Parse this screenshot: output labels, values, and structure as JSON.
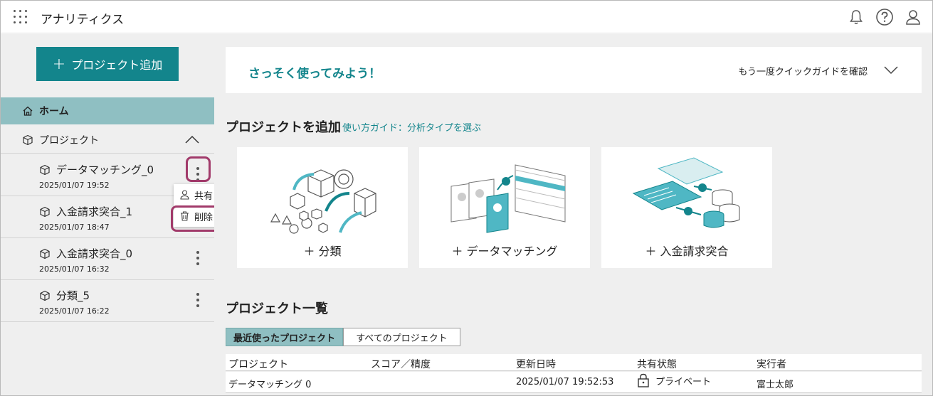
{
  "header": {
    "app_title": "アナリティクス",
    "icons": [
      "apps-grid-icon",
      "bell-icon",
      "help-icon",
      "user-icon"
    ]
  },
  "sidebar": {
    "add_button_label": "プロジェクト追加",
    "home_label": "ホーム",
    "project_label": "プロジェクト",
    "projects": [
      {
        "name": "データマッチング_0",
        "date": "2025/01/07 19:52"
      },
      {
        "name": "入金請求突合_1",
        "date": "2025/01/07 18:47"
      },
      {
        "name": "入金請求突合_0",
        "date": "2025/01/07 16:32"
      },
      {
        "name": "分類_5",
        "date": "2025/01/07 16:22"
      }
    ],
    "context_menu": {
      "share_label": "共有",
      "delete_label": "削除"
    }
  },
  "main": {
    "banner_title": "さっそく使ってみよう！",
    "banner_link": "もう一度クイックガイドを確認",
    "add_section_title": "プロジェクトを追加",
    "guide_link": "使い方ガイド：分析タイプを選ぶ",
    "cards": [
      {
        "label": "分類"
      },
      {
        "label": "データマッチング"
      },
      {
        "label": "入金請求突合"
      }
    ],
    "list_title": "プロジェクト一覧",
    "tabs": [
      {
        "label": "最近使ったプロジェクト",
        "active": true
      },
      {
        "label": "すべてのプロジェクト",
        "active": false
      }
    ],
    "columns": [
      "プロジェクト",
      "スコア／精度",
      "更新日時",
      "共有状態",
      "実行者"
    ],
    "rows": [
      {
        "project": "データマッチング 0",
        "score": "",
        "updated": "2025/01/07 19:52:53",
        "share": "プライベート",
        "user": "富士太郎"
      }
    ]
  },
  "colors": {
    "accent": "#13858c",
    "nav_active": "#8fbfc2",
    "highlight": "#a13a6a"
  }
}
